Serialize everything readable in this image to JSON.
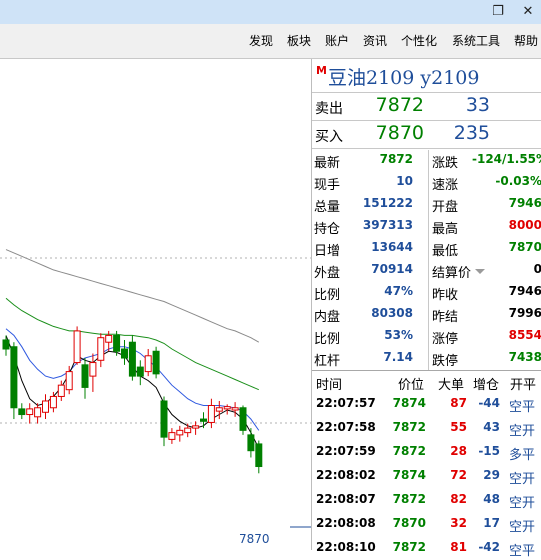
{
  "window": {
    "restore_glyph": "❐",
    "close_glyph": "✕"
  },
  "menu": [
    "发现",
    "板块",
    "账户",
    "资讯",
    "个性化",
    "系统工具",
    "帮助"
  ],
  "header": {
    "marker": "M",
    "name": "豆油2109  y2109"
  },
  "orderbook": {
    "sell": {
      "label": "卖出",
      "price": "7872",
      "volume": "33"
    },
    "buy": {
      "label": "买入",
      "price": "7870",
      "volume": "235"
    }
  },
  "stats": [
    {
      "l1": "最新",
      "v1": "7872",
      "c1": "#008000",
      "l2": "涨跌",
      "v2": "-124/1.55%",
      "c2": "#008000"
    },
    {
      "l1": "现手",
      "v1": "10",
      "c1": "#1f4e9a",
      "l2": "速涨",
      "v2": "-0.03%",
      "c2": "#008000"
    },
    {
      "l1": "总量",
      "v1": "151222",
      "c1": "#1f4e9a",
      "l2": "开盘",
      "v2": "7946",
      "c2": "#008000"
    },
    {
      "l1": "持仓",
      "v1": "397313",
      "c1": "#1f4e9a",
      "l2": "最高",
      "v2": "8000",
      "c2": "#e00000"
    },
    {
      "l1": "日增",
      "v1": "13644",
      "c1": "#1f4e9a",
      "l2": "最低",
      "v2": "7870",
      "c2": "#008000"
    },
    {
      "l1": "外盘",
      "v1": "70914",
      "c1": "#1f4e9a",
      "l2": "结算价",
      "v2": "0",
      "c2": "#000000"
    },
    {
      "l1": "比例",
      "v1": "47%",
      "c1": "#1f4e9a",
      "l2": "昨收",
      "v2": "7946",
      "c2": "#000000"
    },
    {
      "l1": "内盘",
      "v1": "80308",
      "c1": "#1f4e9a",
      "l2": "昨结",
      "v2": "7996",
      "c2": "#000000"
    },
    {
      "l1": "比例",
      "v1": "53%",
      "c1": "#1f4e9a",
      "l2": "涨停",
      "v2": "8554",
      "c2": "#e00000"
    },
    {
      "l1": "杠杆",
      "v1": "7.14",
      "c1": "#1f4e9a",
      "l2": "跌停",
      "v2": "7438",
      "c2": "#008000"
    }
  ],
  "ticks_header": [
    "时间",
    "价位",
    "大单",
    "增仓",
    "开平"
  ],
  "ticks": [
    {
      "time": "22:07:57",
      "price": "7874",
      "vol": "87",
      "oi": "-44",
      "type": "空平"
    },
    {
      "time": "22:07:58",
      "price": "7872",
      "vol": "55",
      "oi": "43",
      "type": "空开"
    },
    {
      "time": "22:07:59",
      "price": "7872",
      "vol": "28",
      "oi": "-15",
      "type": "多平"
    },
    {
      "time": "22:08:02",
      "price": "7874",
      "vol": "72",
      "oi": "29",
      "type": "空开"
    },
    {
      "time": "22:08:07",
      "price": "7872",
      "vol": "82",
      "oi": "48",
      "type": "空开"
    },
    {
      "time": "22:08:08",
      "price": "7870",
      "vol": "32",
      "oi": "17",
      "type": "空开"
    },
    {
      "time": "22:08:10",
      "price": "7872",
      "vol": "81",
      "oi": "-42",
      "type": "空平"
    }
  ],
  "chart": {
    "last_price_label": "7870",
    "candles": [
      {
        "o": 7958,
        "h": 7962,
        "l": 7944,
        "c": 7950
      },
      {
        "o": 7952,
        "h": 7956,
        "l": 7888,
        "c": 7898
      },
      {
        "o": 7897,
        "h": 7902,
        "l": 7888,
        "c": 7892
      },
      {
        "o": 7892,
        "h": 7902,
        "l": 7884,
        "c": 7897
      },
      {
        "o": 7890,
        "h": 7902,
        "l": 7884,
        "c": 7898
      },
      {
        "o": 7894,
        "h": 7910,
        "l": 7888,
        "c": 7904
      },
      {
        "o": 7898,
        "h": 7912,
        "l": 7894,
        "c": 7908
      },
      {
        "o": 7908,
        "h": 7922,
        "l": 7904,
        "c": 7918
      },
      {
        "o": 7914,
        "h": 7935,
        "l": 7910,
        "c": 7930
      },
      {
        "o": 7938,
        "h": 7970,
        "l": 7936,
        "c": 7966
      },
      {
        "o": 7936,
        "h": 7942,
        "l": 7906,
        "c": 7916
      },
      {
        "o": 7926,
        "h": 7946,
        "l": 7912,
        "c": 7938
      },
      {
        "o": 7940,
        "h": 7964,
        "l": 7934,
        "c": 7960
      },
      {
        "o": 7956,
        "h": 7966,
        "l": 7948,
        "c": 7962
      },
      {
        "o": 7962,
        "h": 7966,
        "l": 7944,
        "c": 7948
      },
      {
        "o": 7950,
        "h": 7958,
        "l": 7936,
        "c": 7942
      },
      {
        "o": 7956,
        "h": 7962,
        "l": 7922,
        "c": 7926
      },
      {
        "o": 7934,
        "h": 7940,
        "l": 7918,
        "c": 7926
      },
      {
        "o": 7930,
        "h": 7950,
        "l": 7926,
        "c": 7944
      },
      {
        "o": 7948,
        "h": 7952,
        "l": 7924,
        "c": 7928
      },
      {
        "o": 7904,
        "h": 7908,
        "l": 7864,
        "c": 7872
      },
      {
        "o": 7870,
        "h": 7880,
        "l": 7866,
        "c": 7876
      },
      {
        "o": 7874,
        "h": 7882,
        "l": 7868,
        "c": 7878
      },
      {
        "o": 7876,
        "h": 7884,
        "l": 7872,
        "c": 7880
      },
      {
        "o": 7880,
        "h": 7886,
        "l": 7874,
        "c": 7882
      },
      {
        "o": 7888,
        "h": 7894,
        "l": 7880,
        "c": 7886
      },
      {
        "o": 7885,
        "h": 7906,
        "l": 7880,
        "c": 7900
      },
      {
        "o": 7895,
        "h": 7904,
        "l": 7888,
        "c": 7898
      },
      {
        "o": 7897,
        "h": 7901,
        "l": 7892,
        "c": 7899
      },
      {
        "o": 7896,
        "h": 7903,
        "l": 7890,
        "c": 7898
      },
      {
        "o": 7898,
        "h": 7900,
        "l": 7874,
        "c": 7878
      },
      {
        "o": 7874,
        "h": 7880,
        "l": 7854,
        "c": 7860
      },
      {
        "o": 7866,
        "h": 7869,
        "l": 7840,
        "c": 7846
      }
    ],
    "ma_short": [
      7962,
      7944,
      7922,
      7906,
      7900,
      7902,
      7908,
      7916,
      7928,
      7944,
      7940,
      7938,
      7944,
      7948,
      7947,
      7944,
      7934,
      7926,
      7922,
      7916,
      7902,
      7892,
      7886,
      7882,
      7880,
      7882,
      7888,
      7892,
      7896,
      7894,
      7888,
      7876,
      7862
    ],
    "ma_mid": [
      7968,
      7962,
      7952,
      7940,
      7932,
      7926,
      7924,
      7926,
      7930,
      7938,
      7942,
      7944,
      7946,
      7950,
      7952,
      7952,
      7950,
      7946,
      7940,
      7934,
      7926,
      7918,
      7912,
      7906,
      7902,
      7900,
      7900,
      7900,
      7899,
      7898,
      7895,
      7888,
      7878
    ],
    "ma_long": [
      7995,
      7989,
      7984,
      7980,
      7976,
      7973,
      7970,
      7968,
      7966,
      7966,
      7965,
      7964,
      7963,
      7963,
      7963,
      7962,
      7962,
      7961,
      7960,
      7958,
      7955,
      7950,
      7946,
      7942,
      7938,
      7935,
      7932,
      7929,
      7926,
      7923,
      7920,
      7917,
      7914
    ],
    "ma_very_long": [
      8038,
      8035,
      8032,
      8029,
      8026,
      8023,
      8020,
      8018,
      8016,
      8014,
      8012,
      8010,
      8008,
      8006,
      8004,
      8002,
      8000,
      7998,
      7996,
      7994,
      7992,
      7989,
      7986,
      7983,
      7980,
      7977,
      7974,
      7971,
      7968,
      7966,
      7963,
      7960,
      7956
    ],
    "colors": {
      "up": "#e00000",
      "down": "#008000",
      "ma_short": "#000000",
      "ma_mid": "#2f59e0",
      "ma_long": "#1a8f1a",
      "ma_very_long": "#8a8a8a"
    }
  }
}
